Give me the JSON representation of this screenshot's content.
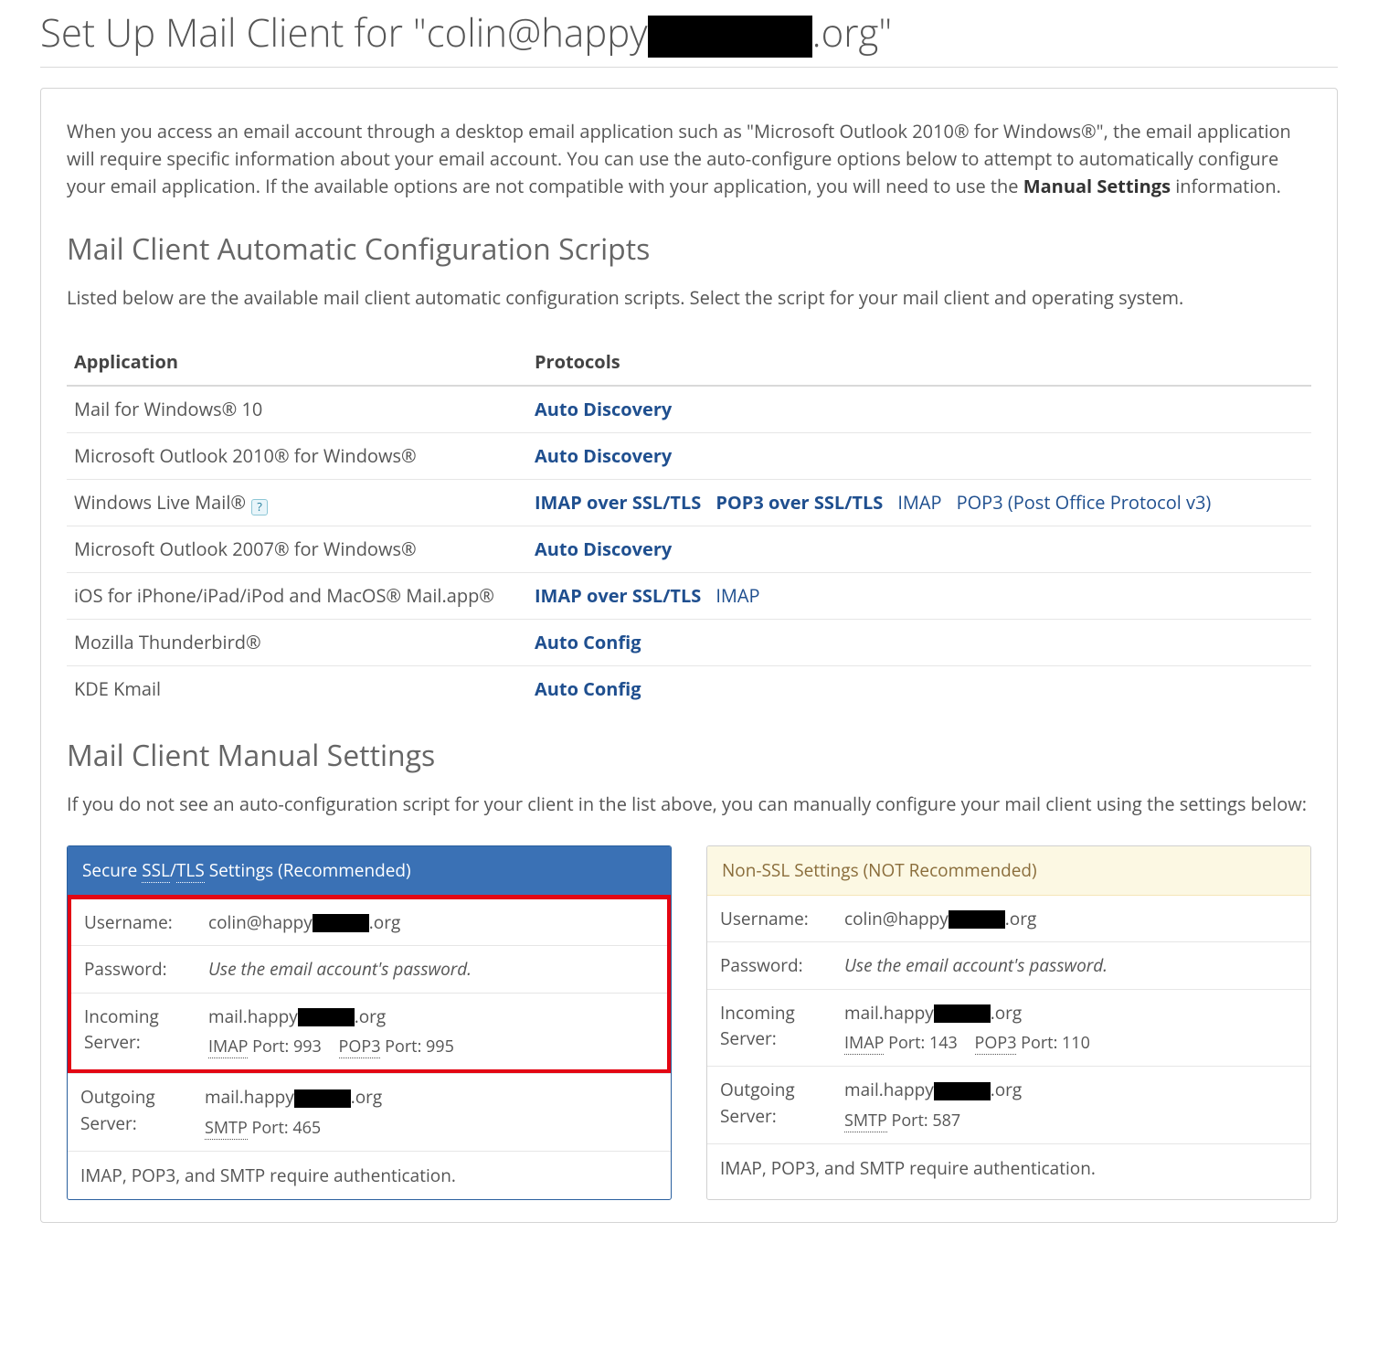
{
  "page": {
    "title_pre": "Set Up Mail Client for \"colin@happy",
    "title_post": ".org\""
  },
  "intro": {
    "text_pre": "When you access an email account through a desktop email application such as \"Microsoft Outlook 2010® for Windows®\", the email application will require specific information about your email account. You can use the auto-configure options below to attempt to automatically configure your email application. If the available options are not compatible with your application, you will need to use the ",
    "manual_label": "Manual Settings",
    "text_post": " information."
  },
  "scripts": {
    "heading": "Mail Client Automatic Configuration Scripts",
    "sub": "Listed below are the available mail client automatic configuration scripts. Select the script for your mail client and operating system.",
    "th_app": "Application",
    "th_proto": "Protocols",
    "rows": [
      {
        "app": "Mail for Windows® 10",
        "links": [
          "Auto Discovery"
        ]
      },
      {
        "app": "Microsoft Outlook 2010® for Windows®",
        "links": [
          "Auto Discovery"
        ]
      },
      {
        "app": "Windows Live Mail®",
        "help": true,
        "links": [
          "IMAP over SSL/TLS",
          "POP3 over SSL/TLS",
          "IMAP",
          "POP3 (Post Office Protocol v3)"
        ],
        "light_from": 2
      },
      {
        "app": "Microsoft Outlook 2007® for Windows®",
        "links": [
          "Auto Discovery"
        ]
      },
      {
        "app": "iOS for iPhone/iPad/iPod and MacOS® Mail.app®",
        "links": [
          "IMAP over SSL/TLS",
          "IMAP"
        ],
        "light_from": 1
      },
      {
        "app": "Mozilla Thunderbird®",
        "links": [
          "Auto Config"
        ]
      },
      {
        "app": "KDE Kmail",
        "links": [
          "Auto Config"
        ]
      }
    ]
  },
  "manual": {
    "heading": "Mail Client Manual Settings",
    "sub": "If you do not see an auto-configuration script for your client in the list above, you can manually configure your mail client using the settings below:"
  },
  "secure": {
    "header_pre": "Secure ",
    "header_ssl": "SSL",
    "header_slash": "/",
    "header_tls": "TLS",
    "header_post": " Settings (Recommended)",
    "username_label": "Username:",
    "password_label": "Password:",
    "incoming_label": "Incoming Server:",
    "outgoing_label": "Outgoing Server:",
    "username_pre": "colin@happy",
    "username_post": ".org",
    "password_hint": "Use the email account's password.",
    "host_pre": "mail.happy",
    "host_post": ".org",
    "imap_label": "IMAP",
    "pop3_label": "POP3",
    "smtp_label": "SMTP",
    "in_imap_port": " Port: 993",
    "in_pop3_port": " Port: 995",
    "out_smtp_port": " Port: 465",
    "note": "IMAP, POP3, and SMTP require authentication."
  },
  "nonssl": {
    "header": "Non-SSL Settings (NOT Recommended)",
    "username_label": "Username:",
    "password_label": "Password:",
    "incoming_label": "Incoming Server:",
    "outgoing_label": "Outgoing Server:",
    "username_pre": "colin@happy",
    "username_post": ".org",
    "password_hint": "Use the email account's password.",
    "host_pre": "mail.happy",
    "host_post": ".org",
    "imap_label": "IMAP",
    "pop3_label": "POP3",
    "smtp_label": "SMTP",
    "in_imap_port": " Port: 143",
    "in_pop3_port": " Port: 110",
    "out_smtp_port": " Port: 587",
    "note": "IMAP, POP3, and SMTP require authentication."
  }
}
